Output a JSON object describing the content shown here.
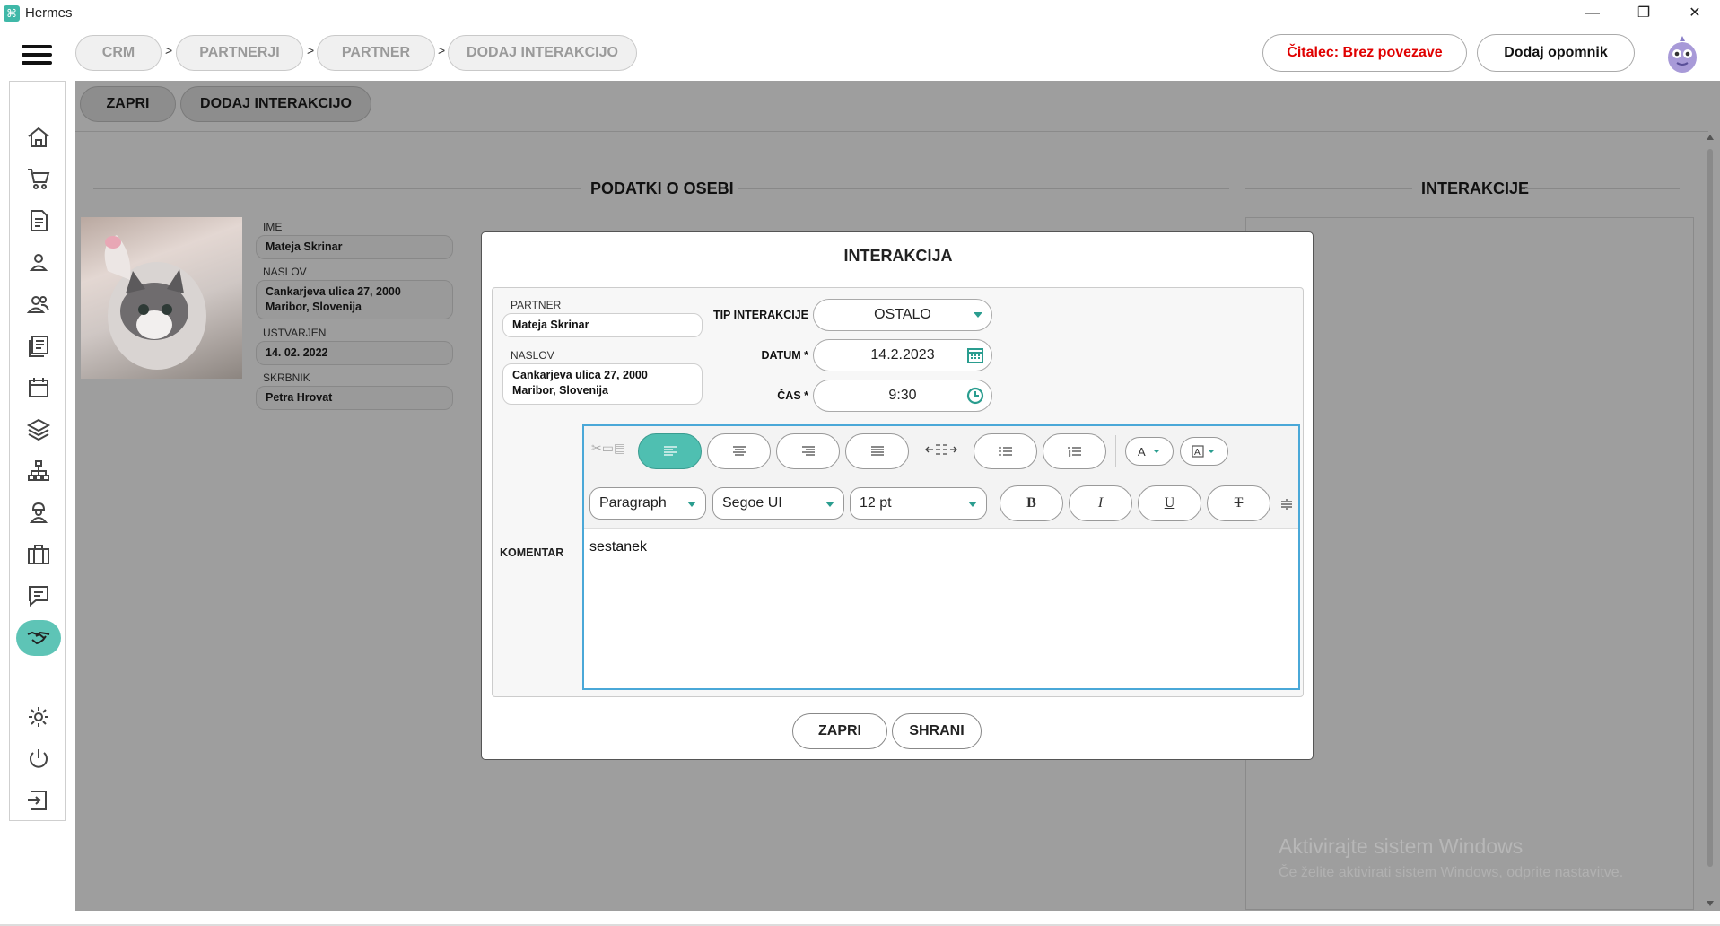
{
  "window": {
    "title": "Hermes",
    "minimize": "—",
    "restore": "❐",
    "close": "✕"
  },
  "breadcrumb": [
    {
      "label": "CRM"
    },
    {
      "label": "PARTNERJI"
    },
    {
      "label": "PARTNER"
    },
    {
      "label": "DODAJ INTERAKCIJO"
    }
  ],
  "breadcrumb_sep": ">",
  "header": {
    "reader_status": "Čitalec: Brez povezave",
    "reader_color": "#e00000",
    "add_reminder": "Dodaj opomnik"
  },
  "sidebar": {
    "items": [
      {
        "icon": "home-icon"
      },
      {
        "icon": "cart-icon"
      },
      {
        "icon": "document-icon"
      },
      {
        "icon": "person-icon"
      },
      {
        "icon": "people-icon"
      },
      {
        "icon": "list-icon"
      },
      {
        "icon": "calendar-icon"
      },
      {
        "icon": "layers-icon"
      },
      {
        "icon": "hierarchy-icon"
      },
      {
        "icon": "worker-icon"
      },
      {
        "icon": "briefcase-icon"
      },
      {
        "icon": "chat-icon"
      },
      {
        "icon": "handshake-icon",
        "active": true
      },
      {
        "icon": "gear-icon"
      },
      {
        "icon": "power-icon"
      },
      {
        "icon": "logout-icon"
      }
    ],
    "accent": "#5ec4b6"
  },
  "toolbar": {
    "close": "ZAPRI",
    "add_interaction": "DODAJ INTERAKCIJO"
  },
  "person": {
    "section_title": "PODATKI O OSEBI",
    "name_label": "IME",
    "name": "Mateja Skrinar",
    "address_label": "NASLOV",
    "address_line1": "Cankarjeva ulica 27, 2000",
    "address_line2": "Maribor, Slovenija",
    "created_label": "USTVARJEN",
    "created": "14. 02. 2022",
    "keeper_label": "SKRBNIK",
    "keeper": "Petra Hrovat"
  },
  "interactions": {
    "section_title": "INTERAKCIJE"
  },
  "watermark": {
    "line1": "Aktivirajte sistem Windows",
    "line2": "Če želite aktivirati sistem Windows, odprite nastavitve."
  },
  "modal": {
    "title": "INTERAKCIJA",
    "partner_label": "PARTNER",
    "partner": "Mateja Skrinar",
    "address_label": "NASLOV",
    "address_line1": "Cankarjeva ulica 27, 2000",
    "address_line2": "Maribor, Slovenija",
    "type_label": "TIP INTERAKCIJE",
    "type_value": "OSTALO",
    "date_label": "DATUM *",
    "date_value": "14.2.2023",
    "time_label": "ČAS *",
    "time_value": "9:30",
    "comment_label": "KOMENTAR",
    "editor": {
      "paragraph": "Paragraph",
      "font": "Segoe UI",
      "size": "12 pt",
      "bold": "B",
      "italic": "I",
      "underline": "U",
      "strike": "T",
      "text": "sestanek"
    },
    "close": "ZAPRI",
    "save": "SHRANI"
  }
}
